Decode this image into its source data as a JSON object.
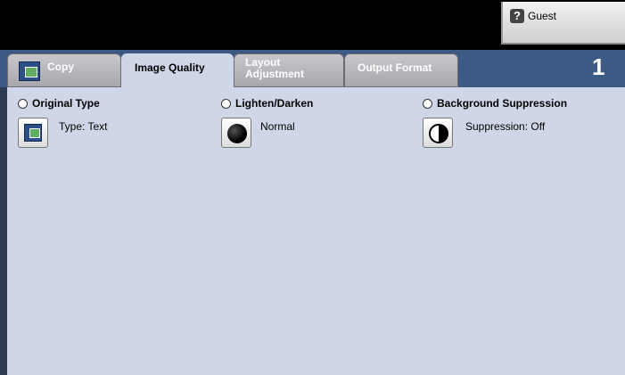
{
  "header": {
    "user_label": "Guest",
    "user_icon": "help-icon"
  },
  "tabs": [
    {
      "label": "Copy",
      "icon": "copy-icon",
      "active": false
    },
    {
      "label": "Image Quality",
      "active": true
    },
    {
      "label": "Layout\nAdjustment",
      "active": false
    },
    {
      "label": "Output Format",
      "active": false
    }
  ],
  "counter": "1",
  "sections": [
    {
      "title": "Original Type",
      "value": "Type: Text",
      "icon": "original-type-icon"
    },
    {
      "title": "Lighten/Darken",
      "value": "Normal",
      "icon": "lighten-darken-icon"
    },
    {
      "title": "Background Suppression",
      "value": "Suppression: Off",
      "icon": "background-suppression-icon"
    }
  ],
  "colors": {
    "tab_strip": "#3d5a84",
    "content_bg": "#cfd6e7",
    "inactive_tab": "#b5b3b9"
  }
}
